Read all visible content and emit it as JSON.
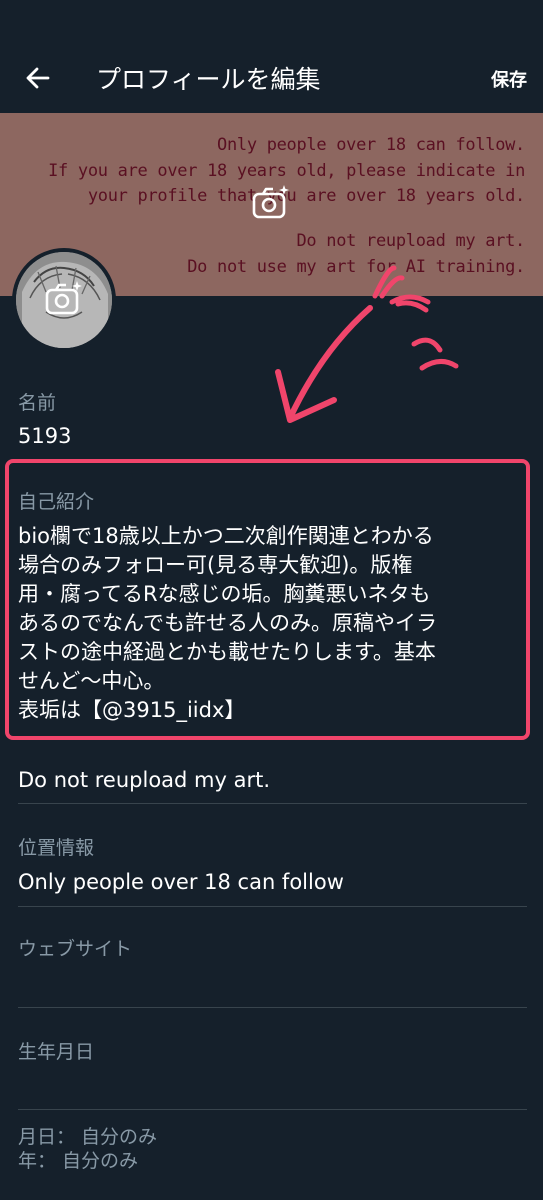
{
  "header": {
    "title": "プロフィールを編集",
    "save_label": "保存"
  },
  "banner": {
    "lines": [
      "Only people over 18 can follow.",
      "If you are over 18 years old, please indicate in",
      "your profile that you are over 18 years old.",
      "Do not reupload my art.",
      "Do not use my art for AI training."
    ]
  },
  "fields": {
    "name_label": "名前",
    "name_value": "5193",
    "bio_label": "自己紹介",
    "bio_lines": [
      "bio欄で18歳以上かつ二次創作関連とわかる",
      "場合のみフォロー可(見る専大歓迎)。版権",
      "用・腐ってるRな感じの垢。胸糞悪いネタも",
      "あるのでなんでも許せる人のみ。原稿やイラ",
      "ストの途中経過とかも載せたりします。基本",
      "せんど〜中心。",
      "表垢は【@3915_iidx】"
    ],
    "bio_extra": "Do not reupload my art.",
    "location_label": "位置情報",
    "location_value": "Only people over 18 can follow",
    "website_label": "ウェブサイト",
    "birthday_label": "生年月日",
    "privacy_month_day": "月日： 自分のみ",
    "privacy_year": "年： 自分のみ"
  },
  "colors": {
    "background": "#15202b",
    "banner": "#8d6760",
    "highlight": "#f0456b",
    "muted_text": "#8899a6"
  },
  "icons": [
    "arrow-left-icon",
    "camera-plus-icon"
  ]
}
